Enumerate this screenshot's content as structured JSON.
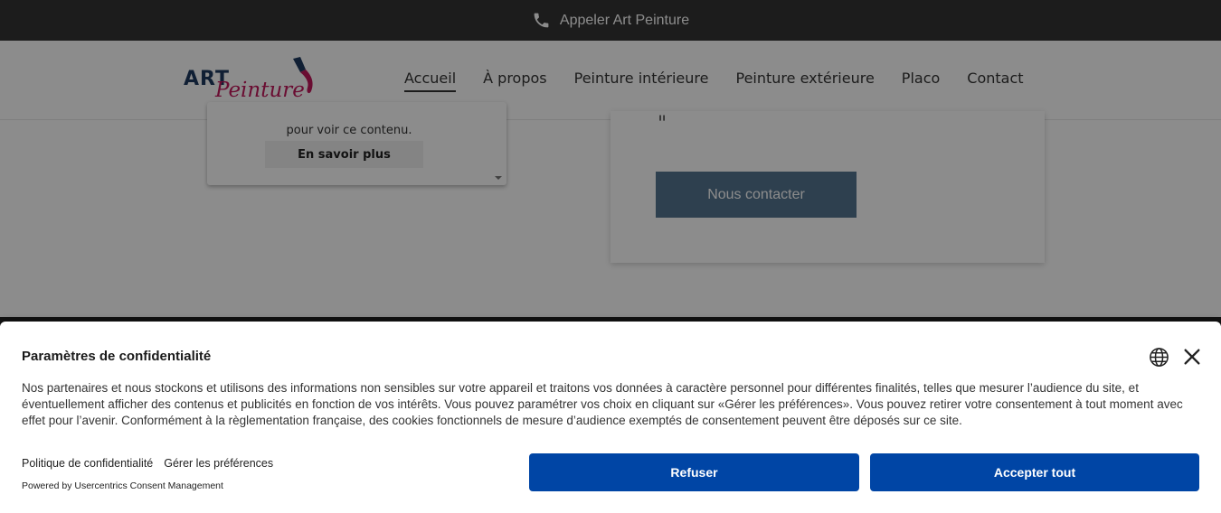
{
  "topbar": {
    "phone_label": "Appeler Art Peinture",
    "icon": "phone-icon"
  },
  "header": {
    "logo": {
      "art": "ART",
      "peinture": "Peinture"
    },
    "nav": [
      {
        "label": "Accueil",
        "active": true
      },
      {
        "label": "À propos"
      },
      {
        "label": "Peinture intérieure"
      },
      {
        "label": "Peinture extérieure"
      },
      {
        "label": "Placo"
      },
      {
        "label": "Contact"
      }
    ]
  },
  "main": {
    "embed": {
      "text": "pour voir ce contenu.",
      "button": "En savoir plus"
    },
    "contact": {
      "quote_mark": "\"",
      "button": "Nous contacter"
    }
  },
  "consent": {
    "title": "Paramètres de confidentialité",
    "body": "Nos partenaires et nous stockons et utilisons des informations non sensibles sur votre appareil et traitons vos données à caractère personnel pour différentes finalités, telles que mesurer l’audience du site, et éventuellement afficher des contenus et publicités en fonction de vos intérêts. Vous pouvez paramétrer vos choix en cliquant sur «Gérer les préférences». Vous pouvez retirer votre consentement à tout moment avec effet pour l’avenir. Conformément à la règlementation française, des cookies fonctionnels de mesure d’audience exemptés de consentement peuvent être déposés sur ce site.",
    "privacy_link": "Politique de confidentialité",
    "manage_link": "Gérer les préférences",
    "powered_by": "Powered by Usercentrics Consent Management",
    "refuse_button": "Refuser",
    "accept_button": "Accepter tout",
    "language_icon": "globe-icon",
    "close_icon": "close-icon"
  },
  "colors": {
    "topbar_bg": "#333333",
    "consent_button": "#0045a5",
    "contact_button": "#547590",
    "logo_navy": "#1e3a5f",
    "logo_pink": "#c2185b"
  }
}
